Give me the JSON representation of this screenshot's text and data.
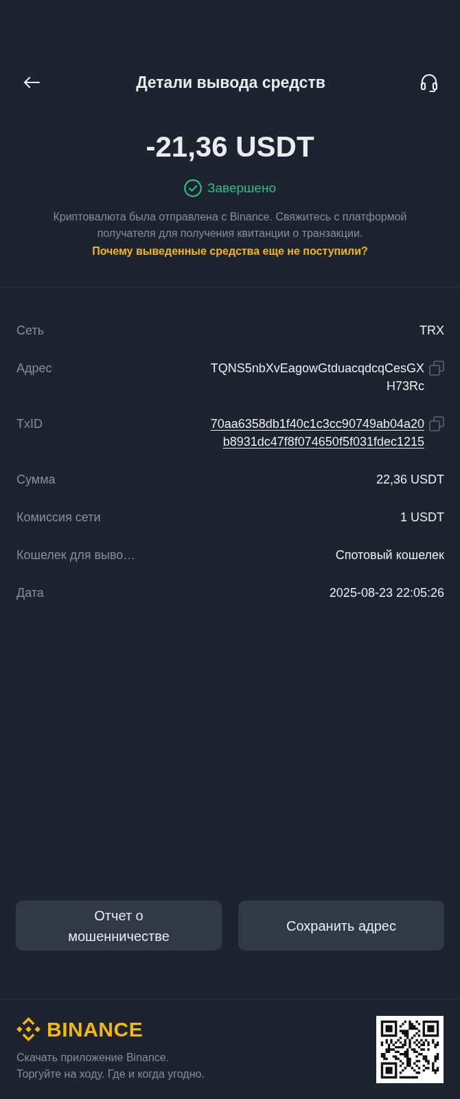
{
  "header": {
    "title": "Детали вывода средств"
  },
  "summary": {
    "amount": "-21,36 USDT",
    "status": {
      "label": "Завершено",
      "kind": "completed"
    },
    "note": "Криптовалюта была отправлена с Binance. Свяжитесь с платформой получателя для получения квитанции о транзакции.",
    "help_link": "Почему выведенные средства еще не поступили?"
  },
  "details": [
    {
      "label": "Сеть",
      "value": "TRX",
      "kind": "text"
    },
    {
      "label": "Адрес",
      "value": "TQNS5nbXvEagowGtduacqdcqCesGXH73Rc",
      "kind": "copyable"
    },
    {
      "label": "TxID",
      "value": "70aa6358db1f40c1c3cc90749ab04a20b8931dc47f8f074650f5f031fdec1215",
      "kind": "link"
    },
    {
      "label": "Сумма",
      "value": "22,36 USDT",
      "kind": "text"
    },
    {
      "label": "Комиссия сети",
      "value": "1 USDT",
      "kind": "text"
    },
    {
      "label": "Кошелек для выво…",
      "value": "Спотовый кошелек",
      "kind": "text"
    },
    {
      "label": "Дата",
      "value": "2025-08-23 22:05:26",
      "kind": "text"
    }
  ],
  "actions": [
    {
      "label": "Отчет о мошенничестве"
    },
    {
      "label": "Сохранить адрес"
    }
  ],
  "footer": {
    "brand": "BINANCE",
    "tagline": "Скачать приложение Binance.\nТоргуйте на ходу. Где и когда угодно."
  }
}
